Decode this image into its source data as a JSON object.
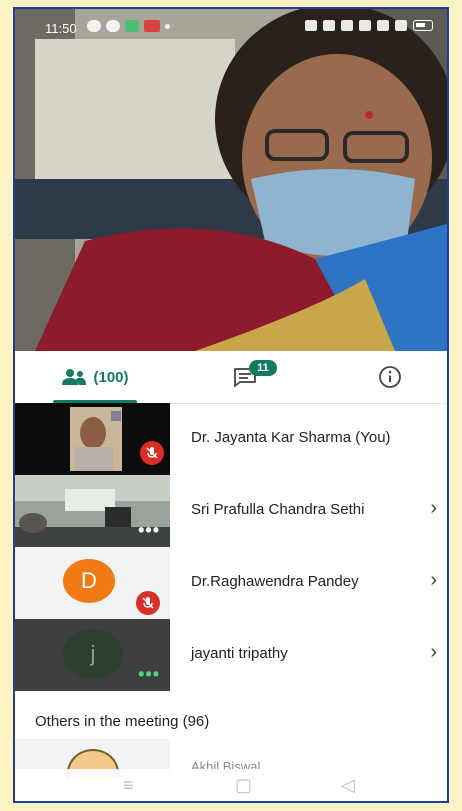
{
  "status_bar": {
    "time": "11:50"
  },
  "tabs": {
    "people_count": "(100)",
    "chat_badge": "11"
  },
  "participants": [
    {
      "name": "Dr. Jayanta Kar Sharma (You)",
      "muted": true,
      "has_chevron": false
    },
    {
      "name": "Sri Prafulla Chandra Sethi",
      "muted": false,
      "has_chevron": true
    },
    {
      "name": "Dr.Raghawendra Pandey",
      "muted": true,
      "has_chevron": true,
      "avatar_letter": "D",
      "avatar_color": "#f07b14"
    },
    {
      "name": "jayanti tripathy",
      "muted": false,
      "has_chevron": true,
      "avatar_letter": "j",
      "avatar_color": "#2e4030"
    }
  ],
  "others_heading": "Others in the meeting (96)",
  "partial_participant_name": "Akhil Biswal",
  "colors": {
    "accent": "#137a63",
    "mute_red": "#d93025",
    "page_bg": "#fbf3c4",
    "frame": "#1f3f8f"
  },
  "icons": {
    "people_tab": "people-icon",
    "chat_tab": "chat-icon",
    "info_tab": "info-icon",
    "mute": "mic-off-icon",
    "more": "more-dots-icon",
    "chevron": "chevron-right-icon"
  }
}
